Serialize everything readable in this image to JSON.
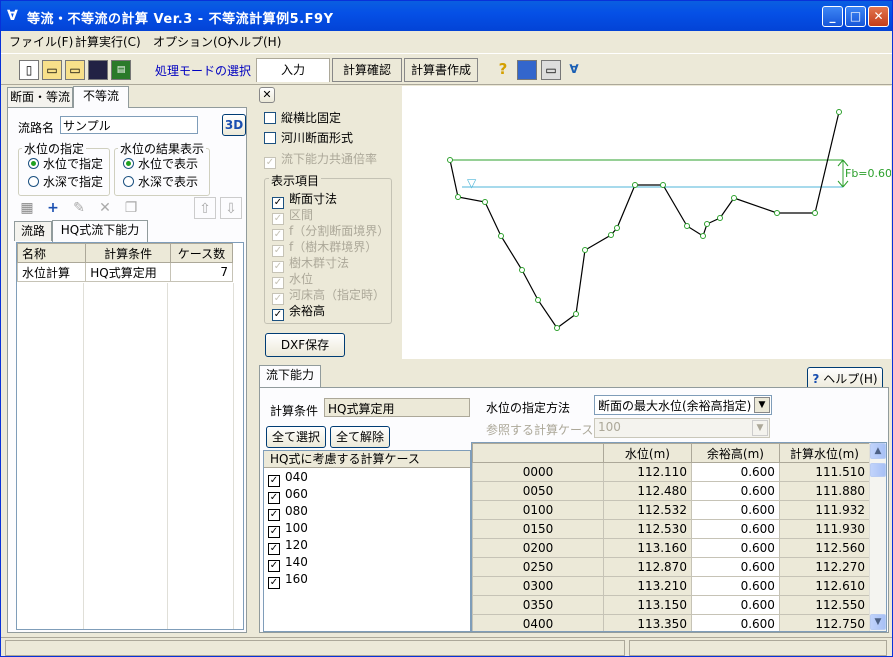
{
  "window": {
    "title": "等流・不等流の計算 Ver.3 - 不等流計算例5.F9Y",
    "min": "_",
    "max": "□",
    "close": "✕"
  },
  "menu": [
    "ファイル(F)",
    "計算実行(C)",
    "オプション(O)",
    "ヘルプ(H)"
  ],
  "toolbar": {
    "mode_label": "処理モードの選択",
    "input": "入力",
    "confirm": "計算確認",
    "report": "計算書作成"
  },
  "left": {
    "tabs": [
      "断面・等流",
      "不等流"
    ],
    "stream_label": "流路名",
    "stream_value": "サンプル",
    "btn_3d": "3D",
    "wl_spec": {
      "title": "水位の指定",
      "opt1": "水位で指定",
      "opt2": "水深で指定"
    },
    "wl_result": {
      "title": "水位の結果表示",
      "opt1": "水位で表示",
      "opt2": "水深で表示"
    },
    "subtabs": [
      "流路",
      "HQ式流下能力"
    ],
    "table": {
      "headers": [
        "名称",
        "計算条件",
        "ケース数"
      ],
      "rows": [
        [
          "水位計算",
          "HQ式算定用",
          "7"
        ]
      ]
    }
  },
  "options": {
    "close": "✕",
    "aspect": "縦横比固定",
    "river_form": "河川断面形式",
    "common_rate": "流下能力共通倍率",
    "display_title": "表示項目",
    "items": [
      {
        "label": "断面寸法",
        "checked": true,
        "enabled": true
      },
      {
        "label": "区間",
        "checked": true,
        "enabled": false
      },
      {
        "label": "f（分割断面境界）",
        "checked": true,
        "enabled": false
      },
      {
        "label": "f（樹木群境界）",
        "checked": true,
        "enabled": false
      },
      {
        "label": "樹木群寸法",
        "checked": true,
        "enabled": false
      },
      {
        "label": "水位",
        "checked": true,
        "enabled": false
      },
      {
        "label": "河床高（指定時）",
        "checked": true,
        "enabled": false
      },
      {
        "label": "余裕高",
        "checked": true,
        "enabled": true
      }
    ],
    "dxf": "DXF保存"
  },
  "plot": {
    "fb_label": "Fb=0.600",
    "wl_marker": "▽"
  },
  "bottom": {
    "tab": "流下能力",
    "help": "ヘルプ(H)",
    "cond_label": "計算条件",
    "cond_value": "HQ式算定用",
    "select_all": "全て選択",
    "deselect_all": "全て解除",
    "case_header": "HQ式に考慮する計算ケース",
    "cases": [
      "040",
      "060",
      "080",
      "100",
      "120",
      "140",
      "160"
    ],
    "wl_method_label": "水位の指定方法",
    "wl_method_value": "断面の最大水位(余裕高指定)",
    "ref_case_label": "参照する計算ケース",
    "ref_case_value": "100",
    "table": {
      "headers": [
        "",
        "水位(m)",
        "余裕高(m)",
        "計算水位(m)"
      ],
      "rows": [
        [
          "0000",
          "112.110",
          "0.600",
          "111.510"
        ],
        [
          "0050",
          "112.480",
          "0.600",
          "111.880"
        ],
        [
          "0100",
          "112.532",
          "0.600",
          "111.932"
        ],
        [
          "0150",
          "112.530",
          "0.600",
          "111.930"
        ],
        [
          "0200",
          "113.160",
          "0.600",
          "112.560"
        ],
        [
          "0250",
          "112.870",
          "0.600",
          "112.270"
        ],
        [
          "0300",
          "113.210",
          "0.600",
          "112.610"
        ],
        [
          "0350",
          "113.150",
          "0.600",
          "112.550"
        ],
        [
          "0400",
          "113.350",
          "0.600",
          "112.750"
        ]
      ]
    }
  },
  "colors": {
    "title_blue": "#0550e6",
    "freeboard": "#2ca02c",
    "water": "#4fb6d8"
  }
}
